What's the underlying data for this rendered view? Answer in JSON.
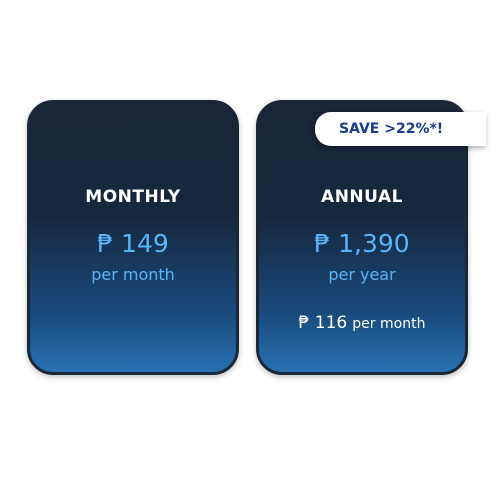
{
  "plans": {
    "monthly": {
      "title": "MONTHLY",
      "price": "₱ 149",
      "period": "per month"
    },
    "annual": {
      "title": "ANNUAL",
      "price": "₱ 1,390",
      "period": "per year",
      "monthly_equivalent_amount": "₱ 116",
      "monthly_equivalent_unit": "per month"
    }
  },
  "badge": {
    "label": "SAVE >22%*!"
  },
  "colors": {
    "card_top": "#1a2536",
    "card_bottom": "#2671b3",
    "price_accent": "#5ab3f7",
    "badge_text": "#1a3a8a"
  }
}
